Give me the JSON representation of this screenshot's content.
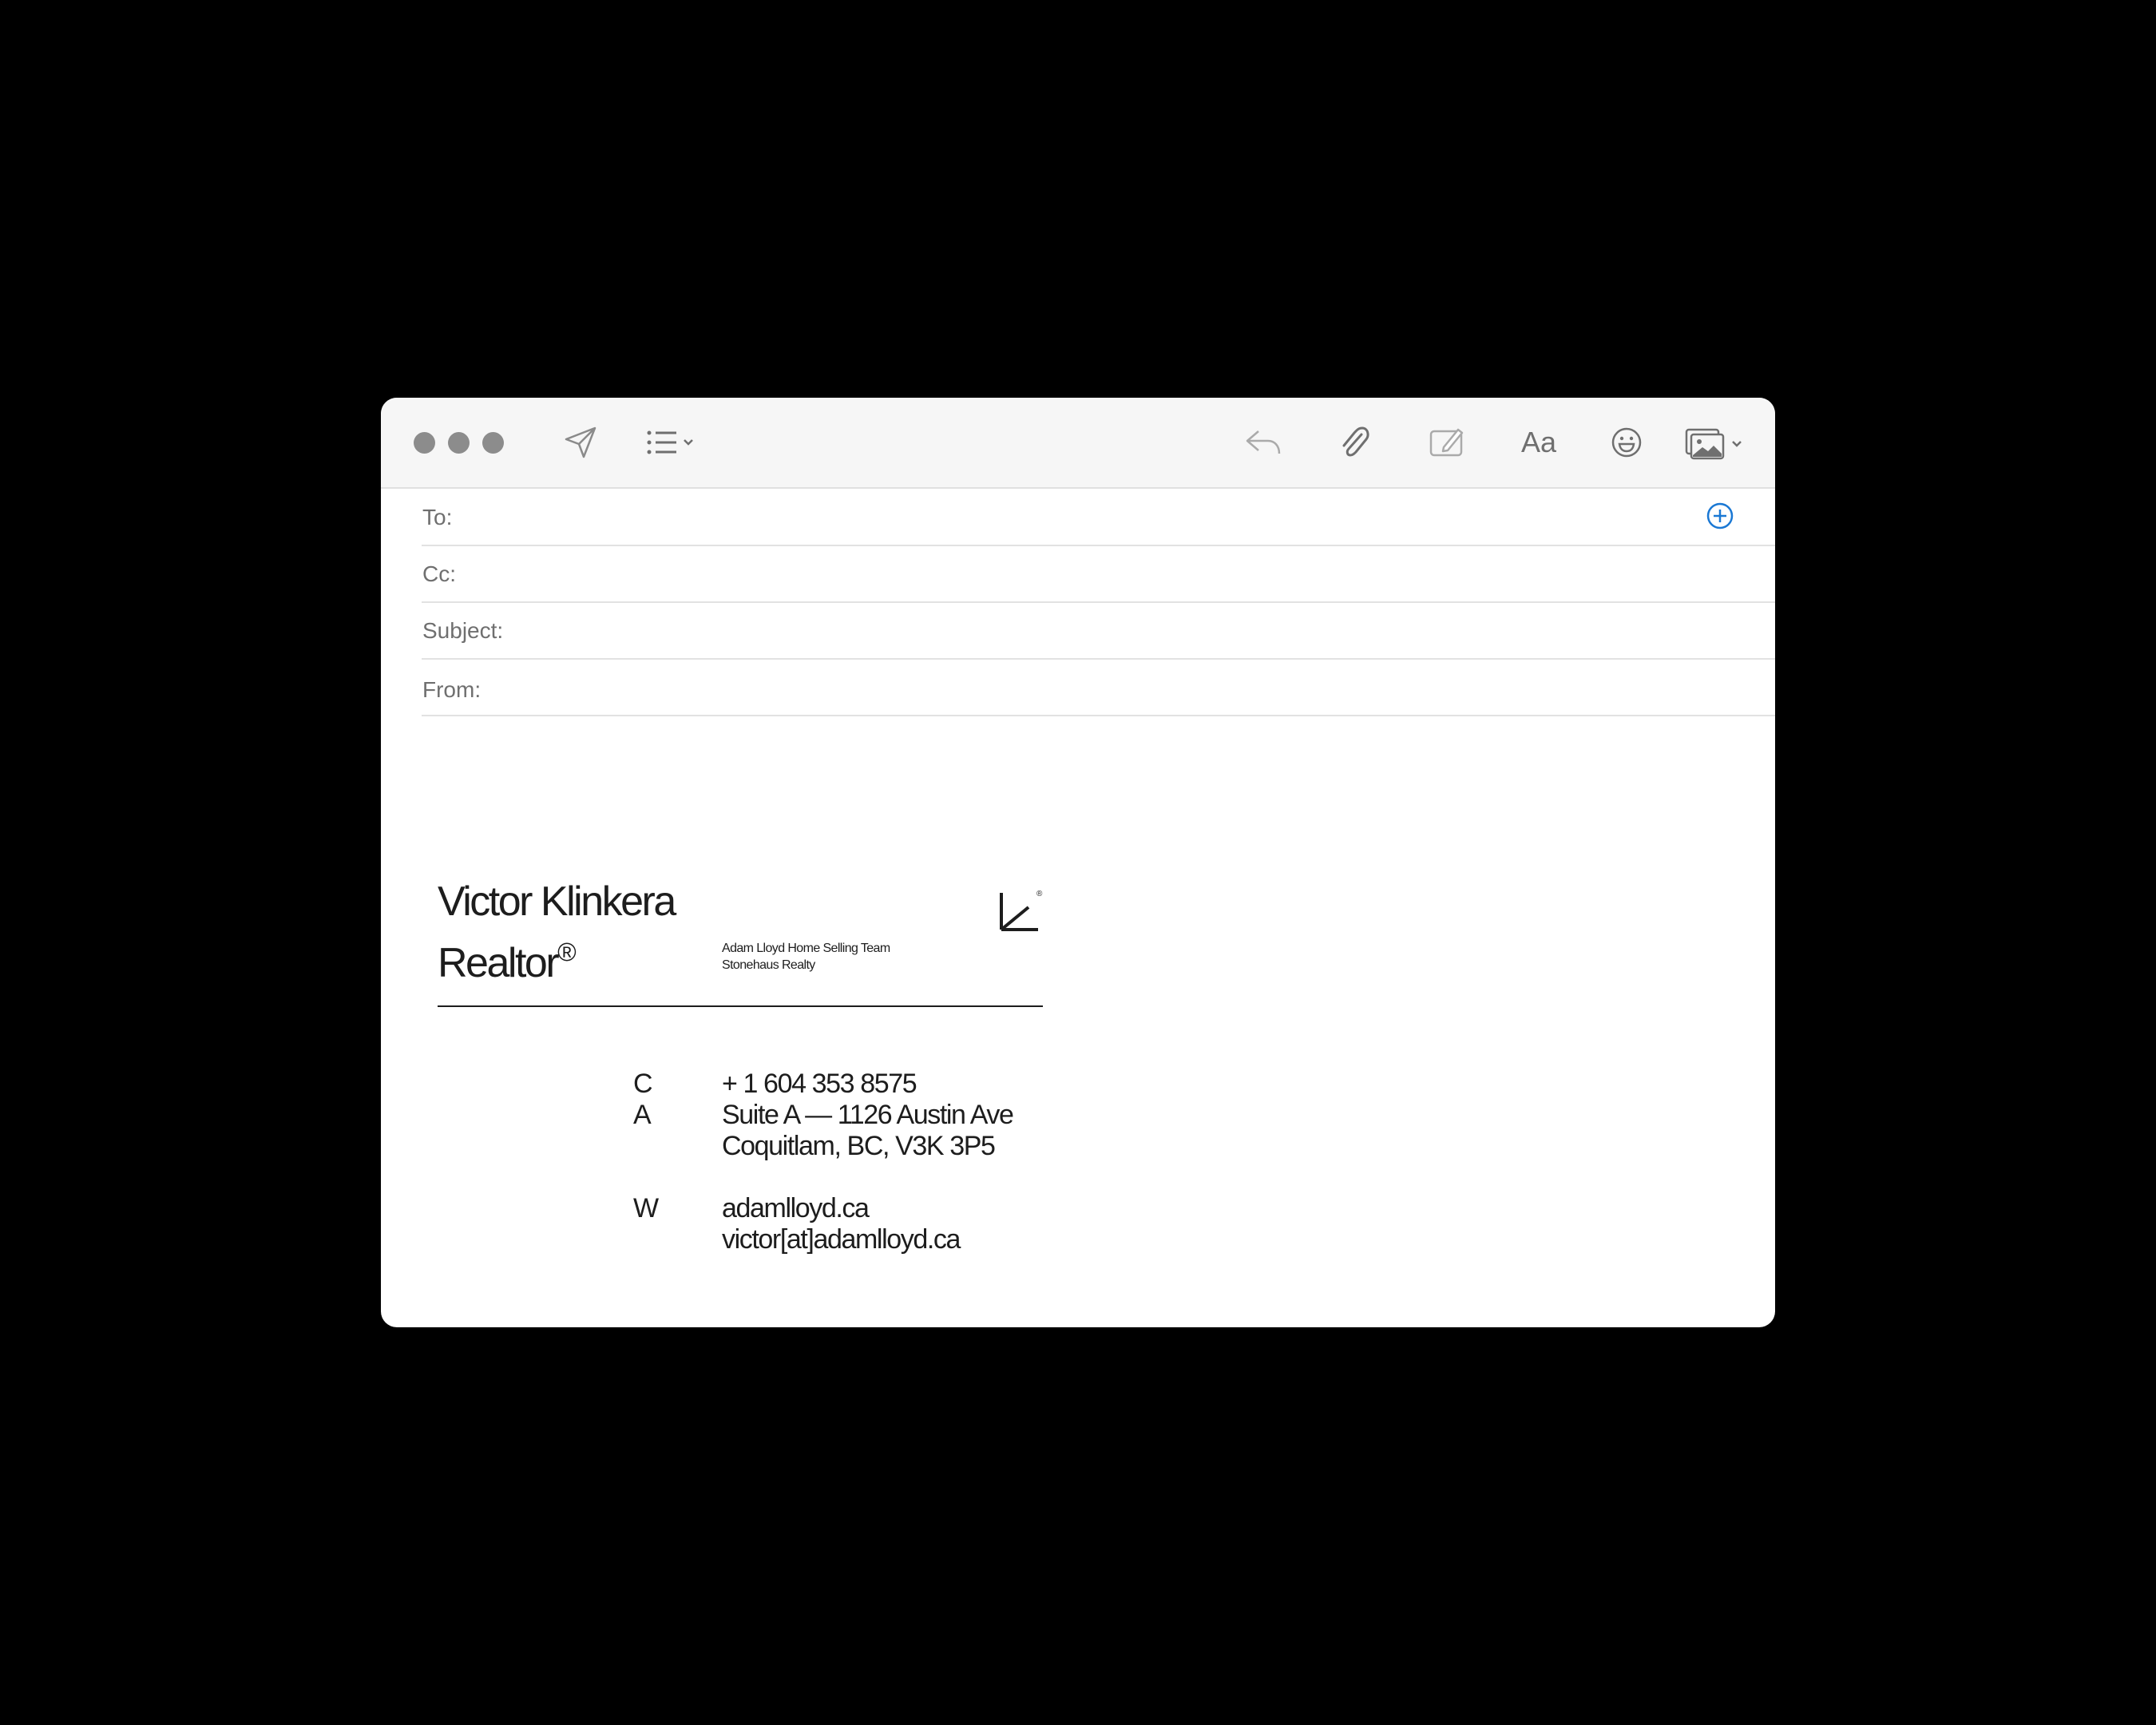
{
  "window": {
    "traffic_lights": [
      "close",
      "minimize",
      "zoom"
    ],
    "toolbar": {
      "send_icon": "paper-plane-icon",
      "format_list_icon": "bulleted-list-icon",
      "reply_icon": "reply-arrow-icon",
      "attach_icon": "paperclip-icon",
      "markup_icon": "markup-pencil-icon",
      "format_label": "Aa",
      "emoji_icon": "smiley-face-icon",
      "photo_icon": "photo-browser-icon"
    }
  },
  "header_fields": {
    "to": {
      "label": "To:",
      "value": ""
    },
    "cc": {
      "label": "Cc:",
      "value": ""
    },
    "subject": {
      "label": "Subject:",
      "value": ""
    },
    "from": {
      "label": "From:",
      "value": ""
    },
    "add_contact_icon": "add-circle-icon"
  },
  "signature": {
    "name": "Victor Klinkera",
    "title": "Realtor",
    "title_mark": "®",
    "team_line1": "Adam Lloyd Home Selling Team",
    "team_line2": "Stonehaus Realty",
    "logo_icon": "adam-lloyd-logo",
    "logo_mark": "®",
    "contact": {
      "cell_label": "C",
      "cell_value": "+ 1 604 353 8575",
      "address_label": "A",
      "address_line1": "Suite A — 1126 Austin Ave",
      "address_line2": "Coquitlam, BC, V3K 3P5",
      "web_label": "W",
      "web_value": "adamlloyd.ca",
      "email_value": "victor[at]adamlloyd.ca"
    }
  },
  "colors": {
    "background": "#000000",
    "toolbar": "#f6f6f6",
    "icon": "#7a7a7a",
    "accent": "#1a78d4",
    "text": "#1d1d1d"
  }
}
